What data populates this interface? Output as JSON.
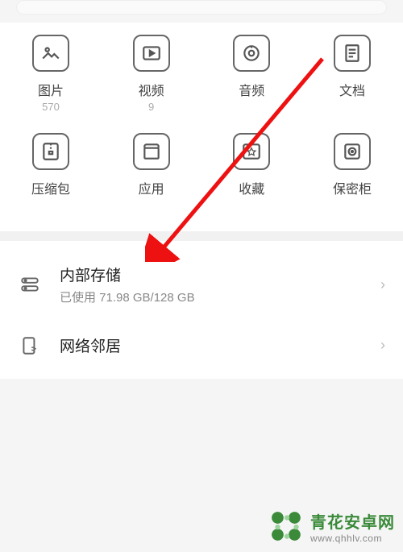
{
  "categories": {
    "row1": [
      {
        "name": "pictures",
        "label": "图片",
        "count": "570"
      },
      {
        "name": "videos",
        "label": "视频",
        "count": "9"
      },
      {
        "name": "audio",
        "label": "音频",
        "count": ""
      },
      {
        "name": "documents",
        "label": "文档",
        "count": ""
      }
    ],
    "row2": [
      {
        "name": "archives",
        "label": "压缩包",
        "count": ""
      },
      {
        "name": "apps",
        "label": "应用",
        "count": ""
      },
      {
        "name": "favorites",
        "label": "收藏",
        "count": ""
      },
      {
        "name": "safe",
        "label": "保密柜",
        "count": ""
      }
    ]
  },
  "storage": {
    "title": "内部存储",
    "subtitle": "已使用 71.98 GB/128 GB"
  },
  "network": {
    "title": "网络邻居"
  },
  "watermark": {
    "title": "青花安卓网",
    "url": "www.qhhlv.com"
  }
}
